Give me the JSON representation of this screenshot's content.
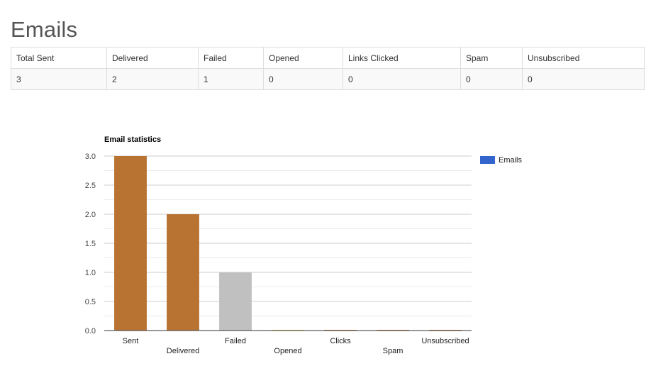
{
  "page": {
    "title": "Emails"
  },
  "table": {
    "headers": [
      "Total Sent",
      "Delivered",
      "Failed",
      "Opened",
      "Links Clicked",
      "Spam",
      "Unsubscribed"
    ],
    "rows": [
      [
        "3",
        "2",
        "1",
        "0",
        "0",
        "0",
        "0"
      ]
    ]
  },
  "chart_data": {
    "type": "bar",
    "title": "Email statistics",
    "categories": [
      "Sent",
      "Delivered",
      "Failed",
      "Opened",
      "Clicks",
      "Spam",
      "Unsubscribed"
    ],
    "series": [
      {
        "name": "Emails",
        "values": [
          3,
          2,
          1,
          0,
          0,
          0,
          0
        ]
      }
    ],
    "bar_colors": [
      "#b87333",
      "#b87333",
      "#c0c0c0",
      "#e2c44a",
      "#b87333",
      "#b87333",
      "#b87333"
    ],
    "legend_color": "#3366cc",
    "ylim": [
      0,
      3
    ],
    "yticks": [
      "0.0",
      "0.5",
      "1.0",
      "1.5",
      "2.0",
      "2.5",
      "3.0"
    ],
    "grid": true,
    "legend_position": "right",
    "xlabel": "",
    "ylabel": ""
  }
}
